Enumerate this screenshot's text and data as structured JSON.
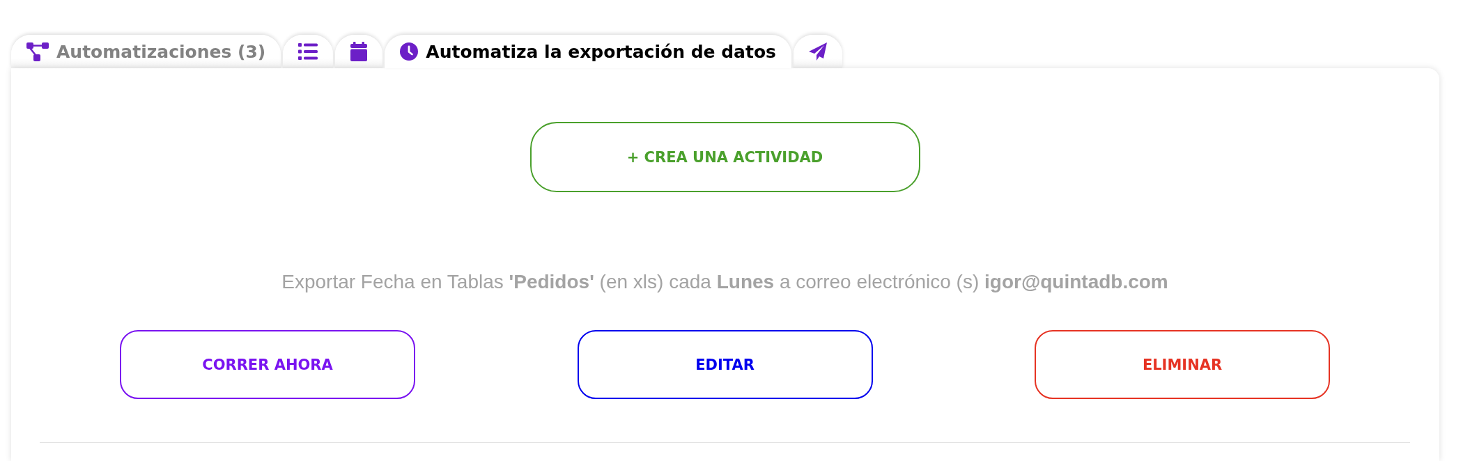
{
  "tabs": [
    {
      "label": "Automatizaciones (3)",
      "selected": false
    },
    {
      "selected": false
    },
    {
      "selected": false
    },
    {
      "label": "Automatiza la exportación de datos",
      "selected": true
    },
    {
      "selected": false
    }
  ],
  "create_button": {
    "label": "+ CREA UNA ACTIVIDAD"
  },
  "summary": "Exportar Fecha en Tablas **'Pedidos'** (en xls) cada **Lunes** a correo electrónico (s) **igor@quintadb.com**",
  "actions": [
    {
      "label": "CORRER AHORA",
      "color": "#7a14f0"
    },
    {
      "label": "EDITAR",
      "color": "#0000ee"
    },
    {
      "label": "ELIMINAR",
      "color": "#e63323"
    }
  ]
}
